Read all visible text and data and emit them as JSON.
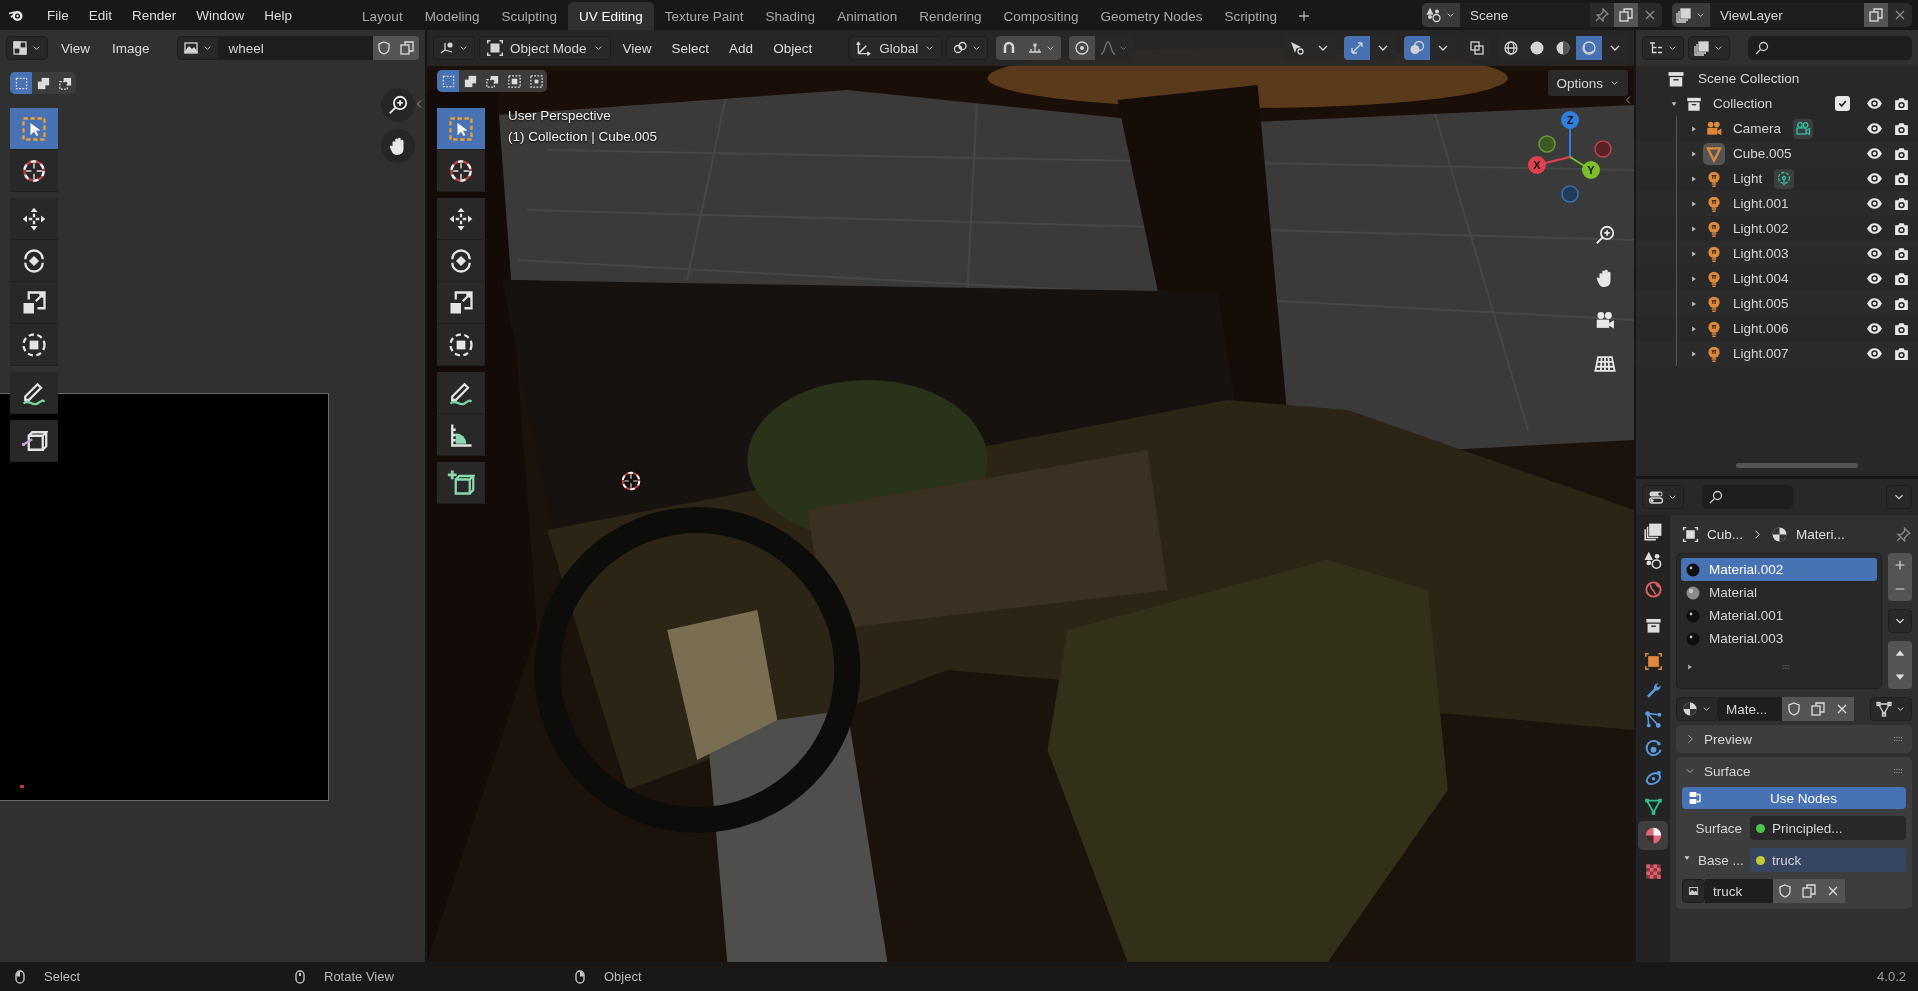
{
  "menu_bar": {
    "menus": [
      "File",
      "Edit",
      "Render",
      "Window",
      "Help"
    ]
  },
  "workspace_tabs": [
    {
      "label": "Layout",
      "selected": false
    },
    {
      "label": "Modeling",
      "selected": false
    },
    {
      "label": "Sculpting",
      "selected": false
    },
    {
      "label": "UV Editing",
      "selected": true
    },
    {
      "label": "Texture Paint",
      "selected": false
    },
    {
      "label": "Shading",
      "selected": false
    },
    {
      "label": "Animation",
      "selected": false
    },
    {
      "label": "Rendering",
      "selected": false
    },
    {
      "label": "Compositing",
      "selected": false
    },
    {
      "label": "Geometry Nodes",
      "selected": false
    },
    {
      "label": "Scripting",
      "selected": false
    }
  ],
  "scene": {
    "value": "Scene"
  },
  "view_layer": {
    "value": "ViewLayer"
  },
  "uv_editor": {
    "menus": [
      "View",
      "Image"
    ],
    "image_name": "wheel",
    "select_modes": [
      {
        "kind": "new",
        "selected": true
      },
      {
        "kind": "extend",
        "selected": false
      },
      {
        "kind": "subtract",
        "selected": false
      }
    ],
    "tools": [
      {
        "kind": "select",
        "selected": true
      },
      {
        "kind": "cursor",
        "selected": false
      },
      {
        "kind": "move",
        "selected": false
      },
      {
        "kind": "rotate",
        "selected": false
      },
      {
        "kind": "scale",
        "selected": false
      },
      {
        "kind": "transform",
        "selected": false
      },
      {
        "kind": "annotate",
        "selected": false
      },
      {
        "kind": "rip",
        "selected": false
      }
    ]
  },
  "viewport": {
    "mode": "Object Mode",
    "menus": [
      "View",
      "Select",
      "Add",
      "Object"
    ],
    "orientation": "Global",
    "toggles": [
      {
        "kind": "selectability",
        "on": false
      },
      {
        "kind": "gizmo",
        "on": true
      },
      {
        "kind": "overlay",
        "on": true
      },
      {
        "kind": "xray",
        "on": false
      }
    ],
    "shading": [
      {
        "kind": "wireframe",
        "selected": false
      },
      {
        "kind": "solid",
        "selected": false
      },
      {
        "kind": "material",
        "selected": false
      },
      {
        "kind": "rendered",
        "selected": true
      }
    ],
    "select_modes": [
      {
        "kind": "new",
        "selected": true
      },
      {
        "kind": "extend",
        "selected": false
      },
      {
        "kind": "subtract",
        "selected": false
      },
      {
        "kind": "invert",
        "selected": false
      },
      {
        "kind": "intersect",
        "selected": false
      }
    ],
    "options": "Options",
    "view_name": "User Perspective",
    "context": "(1) Collection | Cube.005",
    "tools": [
      {
        "kind": "select",
        "selected": true
      },
      {
        "kind": "cursor",
        "selected": false
      },
      {
        "kind": "move",
        "selected": false
      },
      {
        "kind": "rotate",
        "selected": false
      },
      {
        "kind": "scale",
        "selected": false
      },
      {
        "kind": "transform",
        "selected": false
      },
      {
        "kind": "annotate",
        "selected": false
      },
      {
        "kind": "measure",
        "selected": false
      },
      {
        "kind": "add_cube",
        "selected": false
      }
    ],
    "gizmo_axes": [
      {
        "label": "Z"
      },
      {
        "label": "X"
      },
      {
        "label": "Y"
      }
    ]
  },
  "outliner": {
    "root": "Scene Collection",
    "items": [
      {
        "label": "Collection",
        "kind": "collection",
        "expanded": true,
        "checked": true,
        "children": [
          {
            "label": "Camera",
            "kind": "camera",
            "data": {
              "kind": "camera"
            },
            "active": false,
            "expanded": false
          },
          {
            "label": "Cube.005",
            "kind": "mesh",
            "active": true,
            "expanded": false
          },
          {
            "label": "Light",
            "kind": "light",
            "data": {
              "kind": "light"
            },
            "active": false,
            "expanded": false
          },
          {
            "label": "Light.001",
            "kind": "light",
            "active": false,
            "expanded": false
          },
          {
            "label": "Light.002",
            "kind": "light",
            "active": false,
            "expanded": false
          },
          {
            "label": "Light.003",
            "kind": "light",
            "active": false,
            "expanded": false
          },
          {
            "label": "Light.004",
            "kind": "light",
            "active": false,
            "expanded": false
          },
          {
            "label": "Light.005",
            "kind": "light",
            "active": false,
            "expanded": false
          },
          {
            "label": "Light.006",
            "kind": "light",
            "active": false,
            "expanded": false
          },
          {
            "label": "Light.007",
            "kind": "light",
            "active": false,
            "expanded": false
          }
        ]
      }
    ]
  },
  "properties": {
    "tabs": [
      {
        "kind": "output",
        "selected": false
      },
      {
        "kind": "scene",
        "selected": false
      },
      {
        "kind": "world",
        "selected": false
      },
      {
        "kind": "collection",
        "selected": false
      },
      {
        "kind": "object",
        "selected": false
      },
      {
        "kind": "modifier",
        "selected": false
      },
      {
        "kind": "particles",
        "selected": false
      },
      {
        "kind": "physics",
        "selected": false
      },
      {
        "kind": "constraints",
        "selected": false
      },
      {
        "kind": "data",
        "selected": false
      },
      {
        "kind": "material",
        "selected": true
      },
      {
        "kind": "texture",
        "selected": false
      }
    ],
    "breadcrumb": [
      "Cub...",
      "Materi..."
    ],
    "materials": [
      {
        "label": "Material.002",
        "kind": "dark",
        "selected": true
      },
      {
        "label": "Material",
        "kind": "light",
        "selected": false
      },
      {
        "label": "Material.001",
        "kind": "dark",
        "selected": false
      },
      {
        "label": "Material.003",
        "kind": "dark",
        "selected": false
      }
    ],
    "material_name": "Mate...",
    "panels": [
      {
        "label": "Preview",
        "expanded": false
      },
      {
        "label": "Surface",
        "expanded": true
      }
    ],
    "use_nodes": "Use Nodes",
    "shader": {
      "label": "Surface",
      "value": "Principled...",
      "color": "#4ec24e"
    },
    "base_color": {
      "label": "Base ...",
      "value": "truck",
      "color": "#c8c830",
      "expanded": true
    },
    "image": "truck"
  },
  "status_bar": {
    "hints": [
      {
        "kind": "left",
        "label": "Select"
      },
      {
        "kind": "middle",
        "label": "Rotate View"
      },
      {
        "kind": "right",
        "label": "Object"
      }
    ],
    "version": "4.0.2"
  }
}
